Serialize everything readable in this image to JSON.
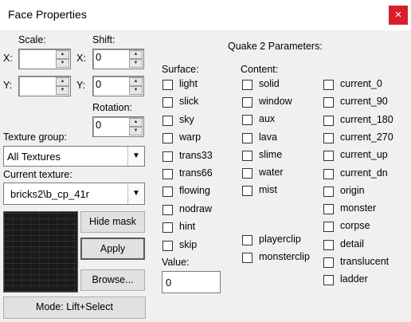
{
  "window": {
    "title": "Face Properties",
    "close_label": "×"
  },
  "transform": {
    "scale_label": "Scale:",
    "shift_label": "Shift:",
    "x_label": "X:",
    "y_label": "Y:",
    "scale_x": "",
    "scale_y": "",
    "shift_x": "0",
    "shift_y": "0",
    "rotation_label": "Rotation:",
    "rotation": "0"
  },
  "texture": {
    "group_label": "Texture group:",
    "group_value": "All Textures",
    "current_label": "Current texture:",
    "current_value": "bricks2\\b_cp_41r"
  },
  "buttons": {
    "hide_mask": "Hide mask",
    "apply": "Apply",
    "browse": "Browse...",
    "mode": "Mode: Lift+Select"
  },
  "quake": {
    "title": "Quake 2 Parameters:",
    "surface_label": "Surface:",
    "content_label": "Content:",
    "surface_items": [
      "light",
      "slick",
      "sky",
      "warp",
      "trans33",
      "trans66",
      "flowing",
      "nodraw",
      "hint",
      "skip"
    ],
    "content_items": [
      "solid",
      "window",
      "aux",
      "lava",
      "slime",
      "water",
      "mist"
    ],
    "content_items_extra": [
      "playerclip",
      "monsterclip"
    ],
    "content_items_right": [
      "current_0",
      "current_90",
      "current_180",
      "current_270",
      "current_up",
      "current_dn",
      "origin",
      "monster",
      "corpse",
      "detail",
      "translucent",
      "ladder"
    ],
    "value_label": "Value:",
    "value": "0"
  }
}
